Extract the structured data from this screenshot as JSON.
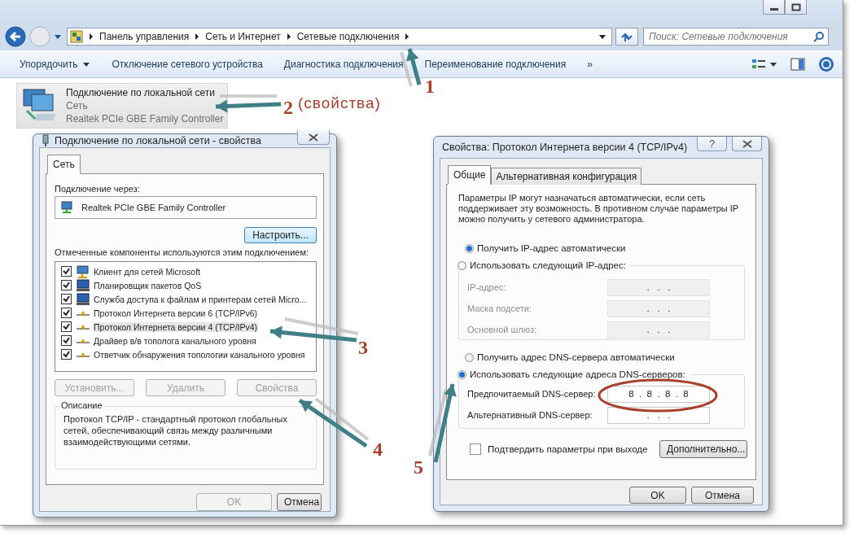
{
  "address_bar": {
    "breadcrumbs": [
      "Панель управления",
      "Сеть и Интернет",
      "Сетевые подключения"
    ]
  },
  "search": {
    "placeholder": "Поиск: Сетевые подключения"
  },
  "toolbar": {
    "items": [
      {
        "label": "Упорядочить",
        "kind": "menu"
      },
      {
        "label": "Отключение сетевого устройства",
        "kind": "plain"
      },
      {
        "label": "Диагностика подключения",
        "kind": "plain"
      },
      {
        "label": "Переименование подключения",
        "kind": "plain"
      }
    ],
    "overflow": "»"
  },
  "connection": {
    "name": "Подключение по локальной сети",
    "network": "Сеть",
    "adapter": "Realtek PCIe GBE Family Controller",
    "selected": true
  },
  "properties_dialog": {
    "title": "Подключение по локальной сети - свойства",
    "tabs": [
      {
        "label": "Сеть",
        "selected": true
      }
    ],
    "connect_using_label": "Подключение через:",
    "adapter": "Realtek PCIe GBE Family Controller",
    "configure_button": "Настроить...",
    "components_label": "Отмеченные компоненты используются этим подключением:",
    "components": [
      {
        "name": "Клиент для сетей Microsoft",
        "kind": "client",
        "checked": true,
        "selected": false
      },
      {
        "name": "Планировщик пакетов QoS",
        "kind": "service",
        "checked": true,
        "selected": false
      },
      {
        "name": "Служба доступа к файлам и принтерам сетей Micro...",
        "kind": "service",
        "checked": true,
        "selected": false
      },
      {
        "name": "Протокол Интернета версии 6 (TCP/IPv6)",
        "kind": "protocol",
        "checked": true,
        "selected": false
      },
      {
        "name": "Протокол Интернета версии 4 (TCP/IPv4)",
        "kind": "protocol",
        "checked": true,
        "selected": true
      },
      {
        "name": "Драйвер в/в тополога канального уровня",
        "kind": "protocol",
        "checked": true,
        "selected": false
      },
      {
        "name": "Ответчик обнаружения топологии канального уровня",
        "kind": "protocol",
        "checked": true,
        "selected": false
      }
    ],
    "buttons": [
      {
        "label": "Установить...",
        "disabled": true
      },
      {
        "label": "Удалить",
        "disabled": true
      },
      {
        "label": "Свойства",
        "disabled": true
      }
    ],
    "description": {
      "title": "Описание",
      "text": "Протокол TCP/IP - стандартный протокол глобальных сетей, обеспечивающий связь между различными взаимодействующими сетями."
    },
    "footer_buttons": [
      {
        "label": "OK",
        "disabled": true
      },
      {
        "label": "Отмена",
        "disabled": false
      }
    ]
  },
  "ipv4_dialog": {
    "title": "Свойства: Протокол Интернета версии 4 (TCP/IPv4)",
    "help_button": "?",
    "tabs": [
      {
        "label": "Общие",
        "selected": true
      },
      {
        "label": "Альтернативная конфигурация",
        "selected": false
      }
    ],
    "intro": "Параметры IP могут назначаться автоматически, если сеть поддерживает эту возможность. В противном случае параметры IP можно получить у сетевого администратора.",
    "ip_modes": [
      {
        "label": "Получить IP-адрес автоматически",
        "selected": true
      },
      {
        "label": "Использовать следующий IP-адрес:",
        "selected": false
      }
    ],
    "ip_fields": [
      {
        "label": "IP-адрес:",
        "value": ".   .   .",
        "disabled": true
      },
      {
        "label": "Маска подсети:",
        "value": ".   .   .",
        "disabled": true
      },
      {
        "label": "Основной шлюз:",
        "value": ".   .   .",
        "disabled": true
      }
    ],
    "dns_modes": [
      {
        "label": "Получить адрес DNS-сервера автоматически",
        "selected": false
      },
      {
        "label": "Использовать следующие адреса DNS-серверов:",
        "selected": true
      }
    ],
    "dns_fields": [
      {
        "label": "Предпочитаемый DNS-сервер:",
        "value": "8  .  8  .  8  .  8",
        "disabled": false
      },
      {
        "label": "Альтернативный DNS-сервер:",
        "value": ".   .   .",
        "disabled": false
      }
    ],
    "validate_checkbox": {
      "label": "Подтвердить параметры при выходе",
      "checked": false
    },
    "advanced_button": "Дополнительно...",
    "footer_buttons": [
      {
        "label": "OK",
        "disabled": false
      },
      {
        "label": "Отмена",
        "disabled": false
      }
    ]
  },
  "annotations": {
    "numbers": [
      "1",
      "2",
      "3",
      "4",
      "5"
    ],
    "note": "(свойства)"
  }
}
